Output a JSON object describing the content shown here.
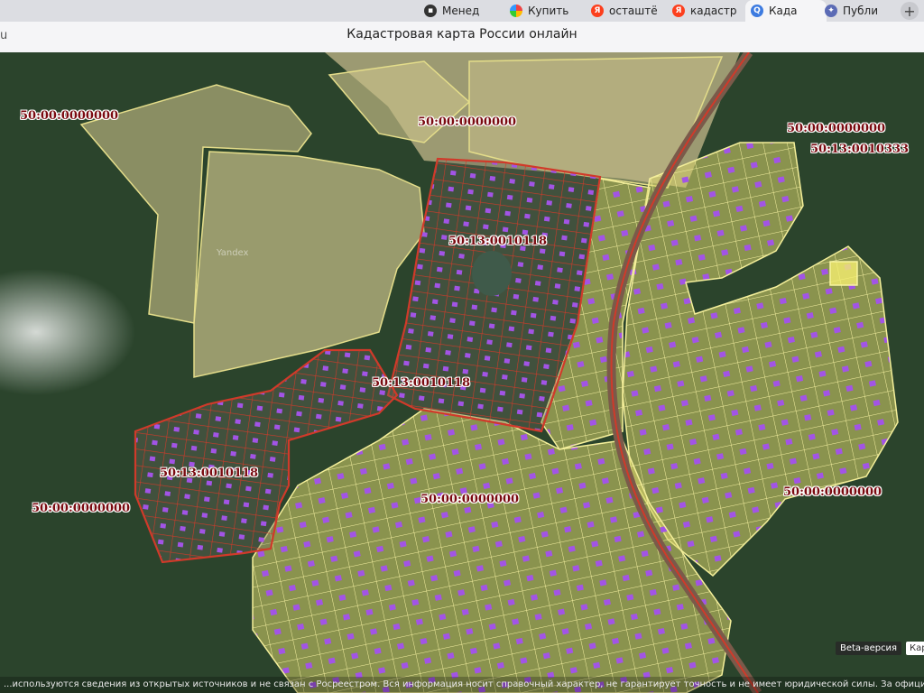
{
  "browser": {
    "tabs": [
      {
        "label": "Менед",
        "icon": "document-icon",
        "color": "#333333"
      },
      {
        "label": "Купить",
        "icon": "colorful-flower-icon",
        "color": "#e44d26"
      },
      {
        "label": "осташтё",
        "icon": "yandex-icon",
        "color": "#fc3f1d"
      },
      {
        "label": "кадастр",
        "icon": "yandex-icon",
        "color": "#fc3f1d"
      },
      {
        "label": "Када",
        "icon": "search-icon",
        "color": "#3d7be0"
      },
      {
        "label": "Публи",
        "icon": "puzzle-icon",
        "color": "#5b6bb5"
      }
    ],
    "new_tab": "+",
    "address_left": "u",
    "page_title": "Кадастровая карта России онлайн"
  },
  "map": {
    "labels": [
      "50:00:0000000",
      "50:00:0000000",
      "50:00:0000000",
      "50:13:0010333",
      "50:13:0010118",
      "50:13:0010118",
      "50:13:0010118",
      "50:00:0000000",
      "50:00:0000000",
      "50:00:0000000"
    ],
    "watermark": "Yandex",
    "beta_badge": "Beta-версия",
    "beta_badge_extra": "Кар",
    "disclaimer": "...используются сведения из открытых источников и не связан с Росреестром. Вся информация носит справочный характер, не гарантирует точность и не имеет юридической силы. За официальны...",
    "colors": {
      "forest": "#2f4a30",
      "field": "#c9c089",
      "yellow_parcel": "#e6e07a",
      "red_boundary": "#d03a2a",
      "building": "#a254e6"
    }
  }
}
